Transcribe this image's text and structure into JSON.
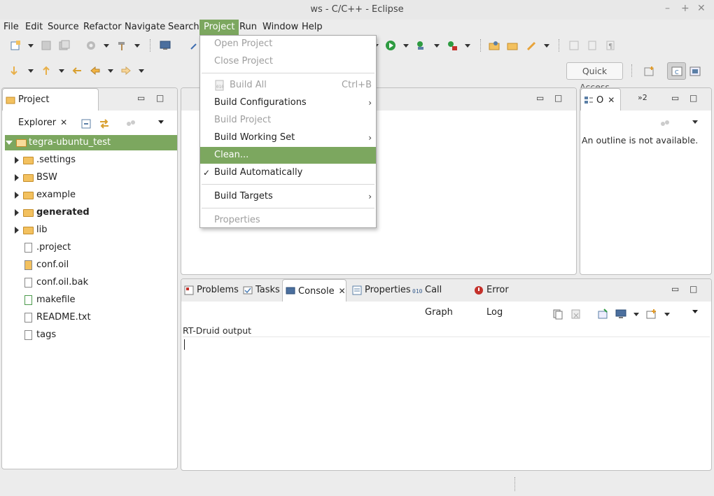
{
  "window": {
    "title": "ws - C/C++ - Eclipse",
    "min": "–",
    "max": "+",
    "close": "✕"
  },
  "menubar": [
    "File",
    "Edit",
    "Source",
    "Refactor",
    "Navigate",
    "Search",
    "Project",
    "Run",
    "Window",
    "Help"
  ],
  "quick_access": "Quick Access",
  "project_explorer": {
    "tab": "Project Explorer",
    "root": "tegra-ubuntu_test",
    "items": [
      ".settings",
      "BSW",
      "example",
      "generated",
      "lib",
      ".project",
      "conf.oil",
      "conf.oil.bak",
      "makefile",
      "README.txt",
      "tags"
    ]
  },
  "outline": {
    "tab": "O",
    "overflow": "»2",
    "message": "An outline is not available."
  },
  "project_menu": {
    "open_project": "Open Project",
    "close_project": "Close Project",
    "build_all": "Build All",
    "build_all_shortcut": "Ctrl+B",
    "build_configurations": "Build Configurations",
    "build_project": "Build Project",
    "build_working_set": "Build Working Set",
    "clean": "Clean...",
    "build_automatically": "Build Automatically",
    "build_targets": "Build Targets",
    "properties": "Properties",
    "check": "✓",
    "submenu": "›"
  },
  "bottom_tabs": {
    "problems": "Problems",
    "tasks": "Tasks",
    "console": "Console",
    "properties": "Properties",
    "call_graph": "Call Graph",
    "error_log": "Error Log"
  },
  "console": {
    "label": "RT-Druid output"
  },
  "colors": {
    "accent": "#7ca75f",
    "folder": "#f3c15f"
  }
}
